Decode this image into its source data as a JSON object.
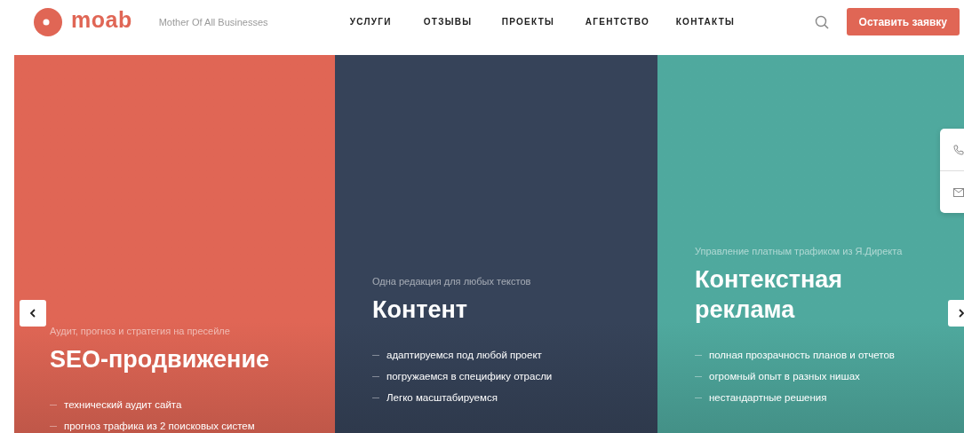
{
  "header": {
    "logo": "moab",
    "tagline": "Mother Of All Businesses",
    "nav": [
      "УСЛУГИ",
      "ОТЗЫВЫ",
      "ПРОЕКТЫ",
      "АГЕНТСТВО",
      "КОНТАКТЫ"
    ],
    "cta": "Оставить заявку"
  },
  "slides": [
    {
      "kind": "seo",
      "color": "#e06655",
      "subtitle": "Аудит, прогноз и стратегия на пресейле",
      "title": "SEO-продвижение",
      "features": [
        "технический аудит сайта",
        "прогноз трафика из 2 поисковых систем"
      ]
    },
    {
      "kind": "content",
      "color": "#364359",
      "subtitle": "Одна редакция для любых текстов",
      "title": "Контент",
      "features": [
        "адаптируемся под любой проект",
        "погружаемся в специфику отрасли",
        "Легко масштабируемся"
      ]
    },
    {
      "kind": "ads",
      "color": "#4fa99e",
      "subtitle": "Управление платным трафиком из Я.Директа",
      "title": "Контекстная реклама",
      "features": [
        "полная прозрачность планов и отчетов",
        "огромный опыт в разных нишах",
        "нестандартные решения"
      ]
    }
  ]
}
